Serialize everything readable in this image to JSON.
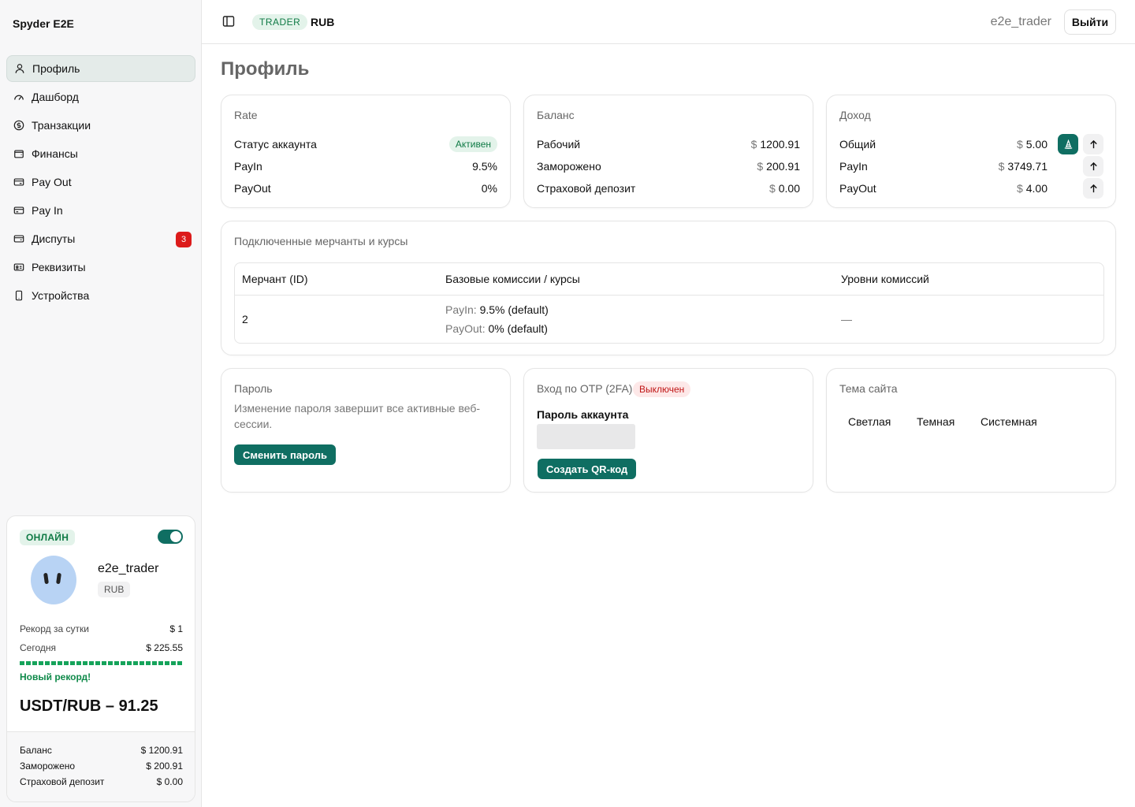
{
  "app": {
    "brand": "Spyder E2E"
  },
  "sidebar": {
    "items": [
      {
        "label": "Профиль",
        "icon": "user-icon"
      },
      {
        "label": "Дашборд",
        "icon": "gauge-icon"
      },
      {
        "label": "Транзакции",
        "icon": "dollar-circle-icon"
      },
      {
        "label": "Финансы",
        "icon": "wallet-icon"
      },
      {
        "label": "Pay Out",
        "icon": "card-out-icon"
      },
      {
        "label": "Pay In",
        "icon": "card-in-icon"
      },
      {
        "label": "Диспуты",
        "icon": "dispute-icon",
        "badge": "3"
      },
      {
        "label": "Реквизиты",
        "icon": "id-card-icon"
      },
      {
        "label": "Устройства",
        "icon": "phone-icon"
      }
    ]
  },
  "status_card": {
    "online_label": "ОНЛАЙН",
    "username": "e2e_trader",
    "currency": "RUB",
    "record_label": "Рекорд за сутки",
    "record_value": "$ 1",
    "today_label": "Сегодня",
    "today_value": "$ 225.55",
    "new_record": "Новый рекорд!",
    "rate": "USDT/RUB – 91.25",
    "balance_label": "Баланс",
    "balance_value": "$ 1200.91",
    "frozen_label": "Заморожено",
    "frozen_value": "$ 200.91",
    "deposit_label": "Страховой депозит",
    "deposit_value": "$ 0.00"
  },
  "topbar": {
    "role": "TRADER",
    "currency": "RUB",
    "user": "e2e_trader",
    "logout": "Выйти"
  },
  "page": {
    "title": "Профиль"
  },
  "rate_card": {
    "title": "Rate",
    "status_label": "Статус аккаунта",
    "status_value": "Активен",
    "payin_label": "PayIn",
    "payin_value": "9.5%",
    "payout_label": "PayOut",
    "payout_value": "0%"
  },
  "balance_card": {
    "title": "Баланс",
    "working_label": "Рабочий",
    "working_value": "1200.91",
    "frozen_label": "Заморожено",
    "frozen_value": "200.91",
    "deposit_label": "Страховой депозит",
    "deposit_value": "0.00",
    "currency_symbol": "$"
  },
  "income_card": {
    "title": "Доход",
    "total_label": "Общий",
    "total_value": "5.00",
    "payin_label": "PayIn",
    "payin_value": "3749.71",
    "payout_label": "PayOut",
    "payout_value": "4.00",
    "currency_symbol": "$"
  },
  "merchants_card": {
    "title": "Подключенные мерчанты и курсы",
    "columns": [
      "Мерчант (ID)",
      "Базовые комиссии / курсы",
      "Уровни комиссий"
    ],
    "rows": [
      {
        "merchant": "2",
        "payin_key": "PayIn:",
        "payin_val": "9.5% (default)",
        "payout_key": "PayOut:",
        "payout_val": "0% (default)",
        "levels": "—"
      }
    ]
  },
  "password_card": {
    "title": "Пароль",
    "description": "Изменение пароля завершит все активные веб-сессии.",
    "button": "Сменить пароль"
  },
  "otp_card": {
    "title": "Вход по OTP (2FA)",
    "status": "Выключен",
    "password_label": "Пароль аккаунта",
    "button": "Создать QR-код"
  },
  "theme_card": {
    "title": "Тема сайта",
    "options": [
      "Светлая",
      "Темная",
      "Системная"
    ]
  },
  "colors": {
    "accent": "#0f6e62",
    "success": "#0f7a45",
    "danger": "#dc1b1b"
  }
}
